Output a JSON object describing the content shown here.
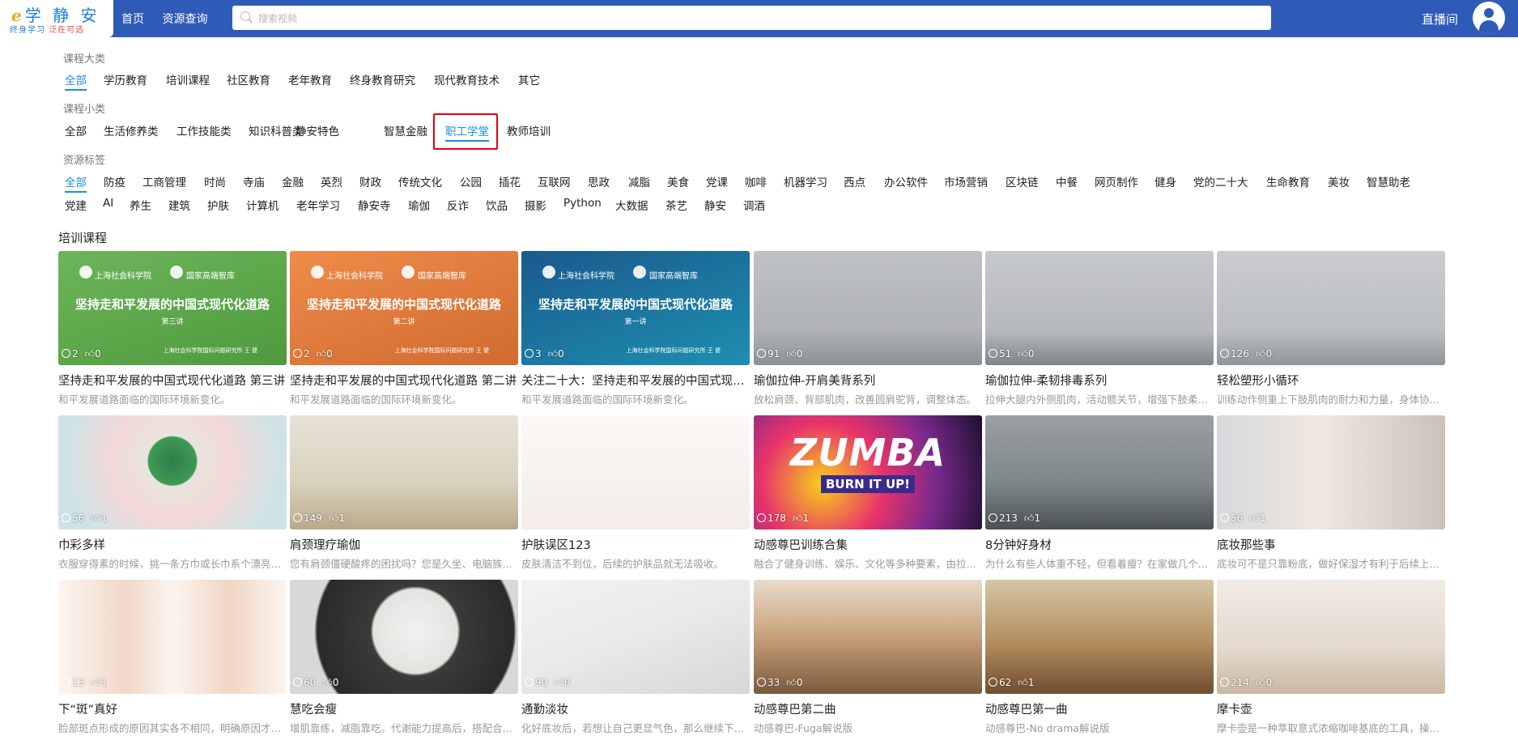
{
  "header": {
    "logo_main": "学 静 安",
    "logo_e": "e",
    "logo_sub_a": "终身学习",
    "logo_sub_b": "泛在可选",
    "nav_home": "首页",
    "nav_resource": "资源查询",
    "search_placeholder": "搜索视频",
    "live_label": "直播间"
  },
  "filters": {
    "category_label": "课程大类",
    "categories": [
      "全部",
      "学历教育",
      "培训课程",
      "社区教育",
      "老年教育",
      "终身教育研究",
      "现代教育技术",
      "其它"
    ],
    "subcategory_label": "课程小类",
    "subcategories": [
      "全部",
      "生活修养类",
      "工作技能类",
      "知识科普类",
      "静安特色",
      "智慧金融",
      "职工学堂",
      "教师培训"
    ],
    "tag_label": "资源标签",
    "tags_row1": [
      "全部",
      "防疫",
      "工商管理",
      "时尚",
      "寺庙",
      "金融",
      "英烈",
      "财政",
      "传统文化",
      "公园",
      "插花",
      "互联网",
      "思政",
      "减脂",
      "美食",
      "党课",
      "咖啡",
      "机器学习",
      "西点",
      "办公软件",
      "市场营销",
      "区块链",
      "中餐",
      "网页制作",
      "健身",
      "党的二十大",
      "生命教育",
      "美妆",
      "智慧助老"
    ],
    "tags_row2": [
      "党建",
      "AI",
      "养生",
      "建筑",
      "护肤",
      "计算机",
      "老年学习",
      "静安寺",
      "瑜伽",
      "反诈",
      "饮品",
      "摄影",
      "Python",
      "大数据",
      "茶艺",
      "静安",
      "调酒"
    ]
  },
  "section_title": "培训课程",
  "slide_text": {
    "school": "上海社会科学院",
    "think_tank": "国家高端智库",
    "headline": "坚持走和平发展的中国式现代化道路",
    "author": "上海社会科学院国际问题研究所 王 健"
  },
  "courses": [
    {
      "title": "坚持走和平发展的中国式现代化道路 第三讲",
      "desc": "和平发展道路面临的国际环境新变化。",
      "views": "2",
      "likes": "0",
      "lecture": "第三讲"
    },
    {
      "title": "坚持走和平发展的中国式现代化道路 第二讲",
      "desc": "和平发展道路面临的国际环境新变化。",
      "views": "2",
      "likes": "0",
      "lecture": "第二讲"
    },
    {
      "title": "关注二十大：坚持走和平发展的中国式现代化道路",
      "desc": "和平发展道路面临的国际环境新变化。",
      "views": "3",
      "likes": "0",
      "lecture": "第一讲"
    },
    {
      "title": "瑜伽拉伸-开肩美背系列",
      "desc": "放松肩颈、背部肌肉，改善圆肩驼背，调整体态。",
      "views": "91",
      "likes": "0"
    },
    {
      "title": "瑜伽拉伸-柔韧排毒系列",
      "desc": "拉伸大腿内外侧肌肉，活动髋关节，增强下肢柔韧性。",
      "views": "51",
      "likes": "0"
    },
    {
      "title": "轻松塑形小循环",
      "desc": "训练动作侧重上下肢肌肉的耐力和力量，身体协调性。",
      "views": "126",
      "likes": "0"
    },
    {
      "title": "巾彩多样",
      "desc": "衣服穿得素的时候，挑一条方巾或长巾系个漂亮的结。",
      "views": "56",
      "likes": "1"
    },
    {
      "title": "肩颈理疗瑜伽",
      "desc": "您有肩颈僵硬酸疼的困扰吗？您是久坐、电脑族吗？",
      "views": "149",
      "likes": "1"
    },
    {
      "title": "护肤误区123",
      "desc": "皮肤清洁不到位，后续的护肤品就无法吸收。",
      "views": "",
      "likes": ""
    },
    {
      "title": "动感尊巴训练合集",
      "desc": "融合了健身训练、娱乐、文化等多种要素，由拉丁舞蹈演变而来。",
      "views": "178",
      "likes": "1"
    },
    {
      "title": "8分钟好身材",
      "desc": "为什么有些人体重不轻，但看着瘦？在家做几个动作就能有好身材。",
      "views": "213",
      "likes": "1"
    },
    {
      "title": "底妆那些事",
      "desc": "底妆可不是只靠粉底，做好保湿才有利于后续上妆。",
      "views": "56",
      "likes": "1"
    },
    {
      "title": "下“斑”真好",
      "desc": "脸部斑点形成的原因其实各不相同，明确原因才能对症下药。",
      "views": "13",
      "likes": "1"
    },
    {
      "title": "慧吃会瘦",
      "desc": "增肌靠练，减脂靠吃。代谢能力提高后，搭配合理饮食。",
      "views": "60",
      "likes": "0"
    },
    {
      "title": "通勤淡妆",
      "desc": "化好底妆后，若想让自己更显气色，那么继续下一步。",
      "views": "90",
      "likes": "0"
    },
    {
      "title": "动感尊巴第二曲",
      "desc": "动感尊巴-Fuga解说版",
      "views": "33",
      "likes": "0"
    },
    {
      "title": "动感尊巴第一曲",
      "desc": "动感尊巴-No drama解说版",
      "views": "62",
      "likes": "1"
    },
    {
      "title": "摩卡壶",
      "desc": "摩卡壶是一种萃取意式浓缩咖啡基底的工具，操作简单。",
      "views": "214",
      "likes": "0"
    }
  ],
  "zumba": {
    "brand": "ZUMBA",
    "tag": "BURN IT UP!"
  },
  "colors": {
    "header": "#2f5bb8",
    "accent": "#1a8fe0",
    "highlight_box": "#e60012"
  }
}
